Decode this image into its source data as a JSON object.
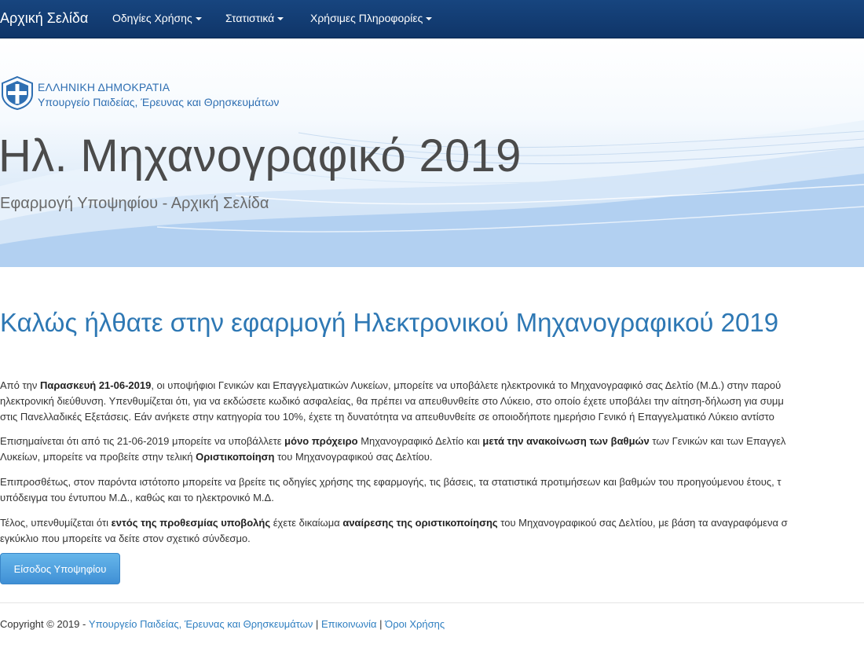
{
  "navbar": {
    "brand": "Αρχική Σελίδα",
    "items": [
      {
        "label": "Οδηγίες Χρήσης"
      },
      {
        "label": "Στατιστικά"
      },
      {
        "label": "Χρήσιμες Πληροφορίες"
      }
    ]
  },
  "banner": {
    "republic": "ΕΛΛΗΝΙΚΗ ΔΗΜΟΚΡΑΤΙΑ",
    "ministry": "Υπουργείο Παιδείας, Έρευνας και Θρησκευμάτων",
    "title": "Ηλ. Μηχανογραφικό 2019",
    "subtitle": "Εφαρμογή Υποψηφίου - Αρχική Σελίδα"
  },
  "main": {
    "heading": "Καλώς ήλθατε στην εφαρμογή Ηλεκτρονικού Μηχανογραφικού 2019",
    "p1": {
      "t1": "Από την ",
      "b1": "Παρασκευή 21-06-2019",
      "t2": ", οι υποψήφιοι Γενικών και Επαγγελματικών Λυκείων, μπορείτε να υποβάλετε ηλεκτρονικά το Μηχανογραφικό σας Δελτίο (Μ.Δ.) στην παρού",
      "line2": "ηλεκτρονική διεύθυνση. Υπενθυμίζεται ότι, για να εκδώσετε κωδικό ασφαλείας, θα πρέπει να απευθυνθείτε στο Λύκειο, στο οποίο έχετε υποβάλει την αίτηση-δήλωση για συμμ",
      "line3": "στις Πανελλαδικές Εξετάσεις. Εάν ανήκετε στην κατηγορία του 10%, έχετε τη δυνατότητα να απευθυνθείτε σε οποιοδήποτε ημερήσιο Γενικό ή Επαγγελματικό Λύκειο αντίστο"
    },
    "p2": {
      "t1": "Επισημαίνεται ότι από τις 21-06-2019 μπορείτε να υποβάλλετε ",
      "b1": "μόνο πρόχειρο",
      "t2": " Μηχανογραφικό Δελτίο και ",
      "b2": "μετά την ανακοίνωση των βαθμών",
      "t3": " των Γενικών και των Επαγγελ",
      "line2a": "Λυκείων, μπορείτε να προβείτε στην τελική ",
      "b3": "Οριστικοποίηση",
      "line2b": " του Μηχανογραφικού σας Δελτίου."
    },
    "p3": {
      "line1": "Επιπροσθέτως, στον παρόντα ιστότοπο μπορείτε να βρείτε τις οδηγίες χρήσης της εφαρμογής, τις βάσεις, τα στατιστικά προτιμήσεων και βαθμών του προηγούμενου έτους, τ",
      "line2": "υπόδειγμα του έντυπου Μ.Δ., καθώς και το ηλεκτρονικό Μ.Δ."
    },
    "p4": {
      "t1": "Τέλος, υπενθυμίζεται ότι ",
      "b1": "εντός της προθεσμίας υποβολής",
      "t2": " έχετε δικαίωμα ",
      "b2": "αναίρεσης της οριστικοποίησης",
      "t3": " του Μηχανογραφικού σας Δελτίου, με βάση τα αναγραφόμενα σ",
      "line2": "εγκύκλιο που μπορείτε να δείτε στον σχετικό σύνδεσμο."
    },
    "login_button": "Είσοδος Υποψηφίου"
  },
  "footer": {
    "copyright": "Copyright © 2019 - ",
    "ministry_link": "Υπουργείο Παιδείας, Έρευνας και Θρησκευμάτων",
    "sep1": " | ",
    "contact_link": "Επικοινωνία",
    "sep2": " | ",
    "terms_link": "Όροι Χρήσης"
  },
  "colors": {
    "navbar": "#17457f",
    "heading": "#2e78b4",
    "link": "#2f7fc1",
    "button": "#4a9ee0"
  }
}
